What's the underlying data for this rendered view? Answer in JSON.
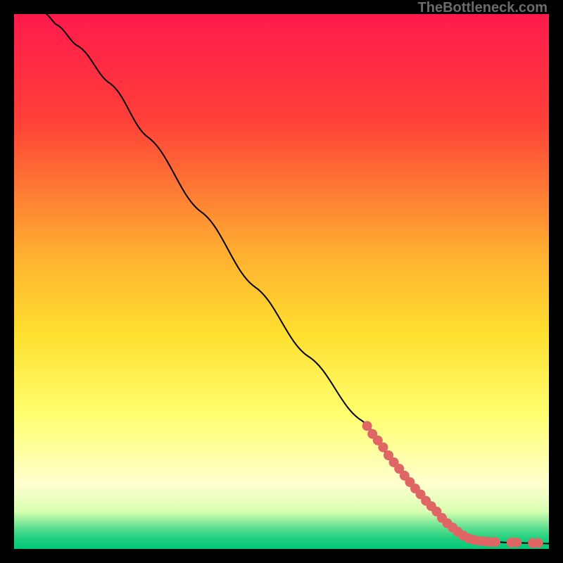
{
  "watermark": "TheBottleneck.com",
  "chart_data": {
    "type": "line",
    "title": "",
    "xlabel": "",
    "ylabel": "",
    "xlim": [
      0,
      100
    ],
    "ylim": [
      0,
      100
    ],
    "gradient_stops": [
      {
        "offset": 0,
        "color": "#ff1a4d"
      },
      {
        "offset": 20,
        "color": "#ff4038"
      },
      {
        "offset": 45,
        "color": "#ffb030"
      },
      {
        "offset": 60,
        "color": "#ffe030"
      },
      {
        "offset": 75,
        "color": "#ffff70"
      },
      {
        "offset": 88,
        "color": "#ffffd0"
      },
      {
        "offset": 93,
        "color": "#d8ffb0"
      },
      {
        "offset": 96,
        "color": "#60e090"
      },
      {
        "offset": 98,
        "color": "#20d080"
      },
      {
        "offset": 100,
        "color": "#00c878"
      }
    ],
    "curve": [
      {
        "x": 6,
        "y": 100
      },
      {
        "x": 8,
        "y": 98
      },
      {
        "x": 12,
        "y": 94
      },
      {
        "x": 18,
        "y": 87
      },
      {
        "x": 25,
        "y": 77
      },
      {
        "x": 35,
        "y": 63
      },
      {
        "x": 45,
        "y": 49
      },
      {
        "x": 55,
        "y": 36
      },
      {
        "x": 65,
        "y": 24
      },
      {
        "x": 72,
        "y": 15
      },
      {
        "x": 78,
        "y": 8
      },
      {
        "x": 82,
        "y": 4
      },
      {
        "x": 85,
        "y": 2
      },
      {
        "x": 88,
        "y": 1.5
      },
      {
        "x": 92,
        "y": 1.2
      },
      {
        "x": 96,
        "y": 1.1
      },
      {
        "x": 100,
        "y": 1.0
      }
    ],
    "markers": [
      {
        "x": 66,
        "y": 23
      },
      {
        "x": 67,
        "y": 21.5
      },
      {
        "x": 68,
        "y": 20.3
      },
      {
        "x": 69,
        "y": 19
      },
      {
        "x": 70,
        "y": 17.5
      },
      {
        "x": 71,
        "y": 16.2
      },
      {
        "x": 72,
        "y": 15
      },
      {
        "x": 73,
        "y": 13.7
      },
      {
        "x": 74,
        "y": 12.5
      },
      {
        "x": 75,
        "y": 11.3
      },
      {
        "x": 76,
        "y": 10.2
      },
      {
        "x": 77,
        "y": 9
      },
      {
        "x": 78,
        "y": 8
      },
      {
        "x": 79,
        "y": 7
      },
      {
        "x": 80,
        "y": 5.8
      },
      {
        "x": 81,
        "y": 4.8
      },
      {
        "x": 82,
        "y": 4
      },
      {
        "x": 83,
        "y": 3.2
      },
      {
        "x": 84,
        "y": 2.5
      },
      {
        "x": 85,
        "y": 2
      },
      {
        "x": 86,
        "y": 1.7
      },
      {
        "x": 87,
        "y": 1.5
      },
      {
        "x": 88,
        "y": 1.4
      },
      {
        "x": 89,
        "y": 1.3
      },
      {
        "x": 90,
        "y": 1.3
      },
      {
        "x": 93,
        "y": 1.2
      },
      {
        "x": 94,
        "y": 1.2
      },
      {
        "x": 97,
        "y": 1.1
      },
      {
        "x": 98,
        "y": 1.1
      }
    ],
    "marker_color": "#e06666",
    "curve_color": "#000000"
  }
}
